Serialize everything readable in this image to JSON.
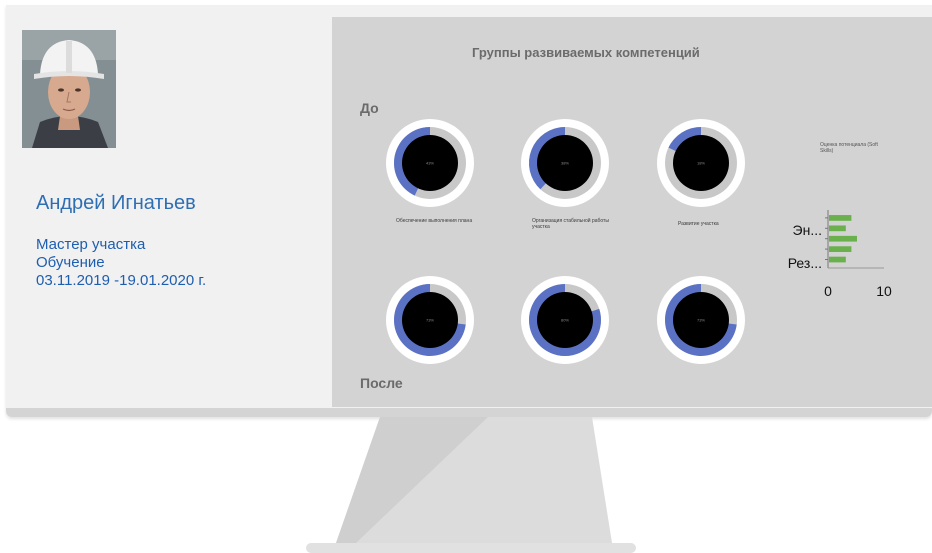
{
  "profile": {
    "name": "Андрей Игнатьев",
    "position": "Мастер участка",
    "program": "Обучение",
    "period": "03.11.2019 -19.01.2020 г."
  },
  "panel": {
    "title": "Группы развиваемых компетенций",
    "before_label": "До",
    "after_label": "После"
  },
  "donuts_before": [
    {
      "caption": "Обеспечение выполнения плана",
      "value_label": "43%",
      "fraction": 0.43
    },
    {
      "caption": "Организация стабильной работы участка",
      "value_label": "38%",
      "fraction": 0.38
    },
    {
      "caption": "Развитие участка",
      "value_label": "18%",
      "fraction": 0.18
    }
  ],
  "donuts_after": [
    {
      "value_label": "73%",
      "fraction": 0.73
    },
    {
      "value_label": "80%",
      "fraction": 0.8
    },
    {
      "value_label": "73%",
      "fraction": 0.73
    }
  ],
  "colors": {
    "donut_fill": "#5b72c4",
    "donut_track": "#c8c8c8",
    "donut_hole": "#000000",
    "bar": "#6ab04c",
    "name_text": "#2e6fb3"
  },
  "chart_data": {
    "type": "bar",
    "orientation": "horizontal",
    "title": "Оценка потенциала (Soft Skills)",
    "category_tick_labels": [
      "Эн...",
      "Рез..."
    ],
    "values": [
      4,
      3,
      5,
      4,
      3
    ],
    "xlim": [
      0,
      10
    ],
    "xticks": [
      "0",
      "10"
    ]
  }
}
